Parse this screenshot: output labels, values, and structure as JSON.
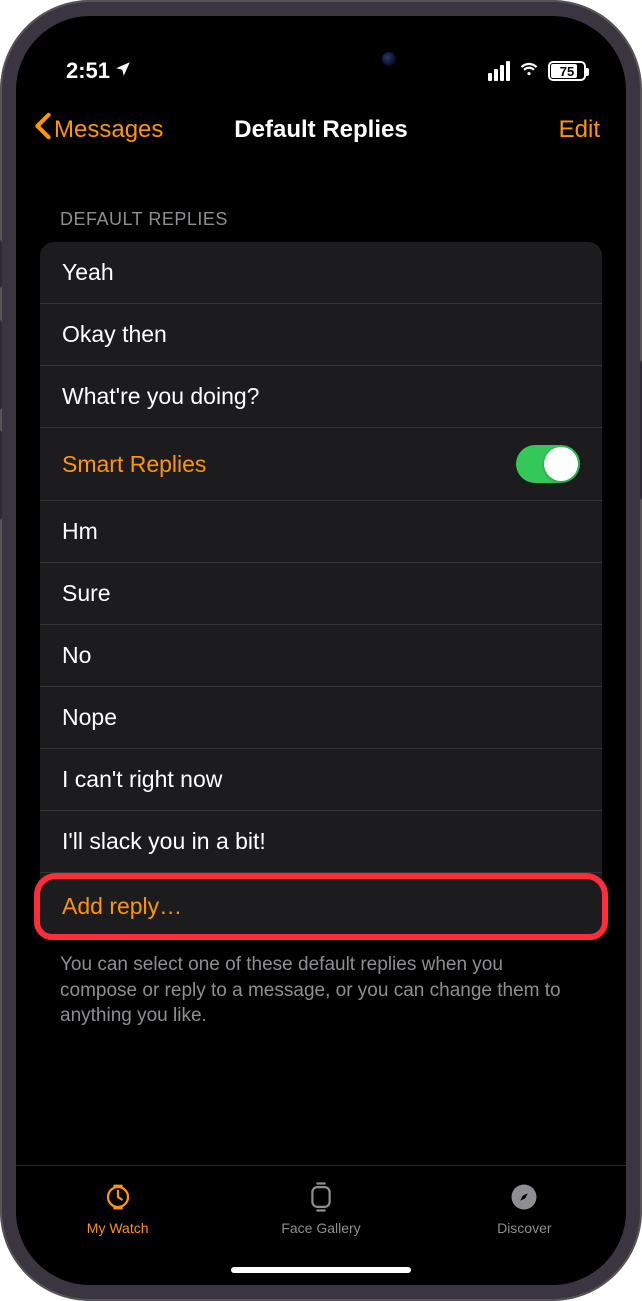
{
  "status": {
    "time": "2:51",
    "battery_pct": "75"
  },
  "nav": {
    "back_label": "Messages",
    "title": "Default Replies",
    "edit_label": "Edit"
  },
  "section": {
    "header": "DEFAULT REPLIES",
    "footer": "You can select one of these default replies when you compose or reply to a message, or you can change them to anything you like."
  },
  "replies": {
    "r0": "Yeah",
    "r1": "Okay then",
    "r2": "What're you doing?",
    "smart_label": "Smart Replies",
    "r3": "Hm",
    "r4": "Sure",
    "r5": "No",
    "r6": "Nope",
    "r7": "I can't right now",
    "r8": "I'll slack you in a bit!",
    "add_label": "Add reply…"
  },
  "tabs": {
    "t0": "My Watch",
    "t1": "Face Gallery",
    "t2": "Discover"
  }
}
